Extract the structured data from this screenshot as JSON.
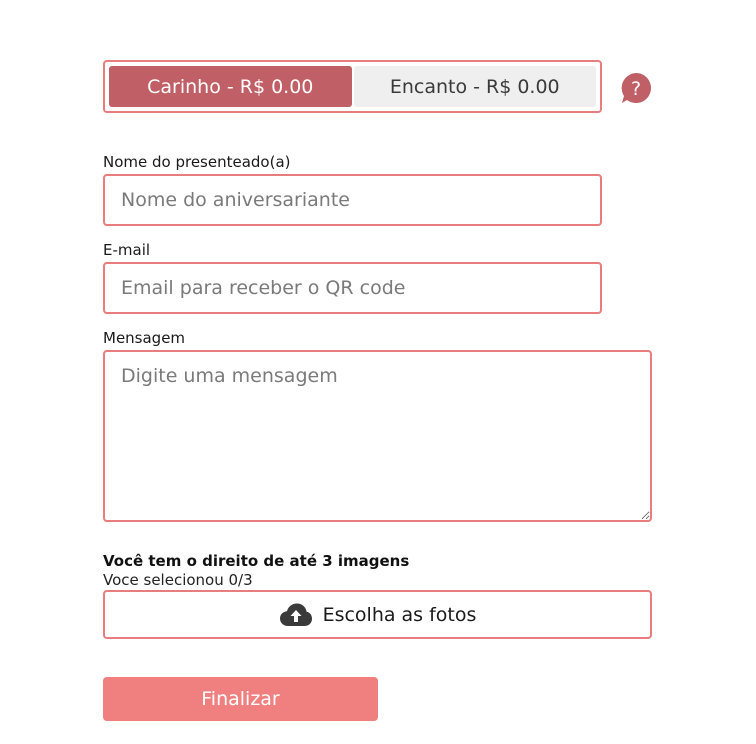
{
  "plans": [
    {
      "label": "Carinho - R$ 0.00",
      "selected": true
    },
    {
      "label": "Encanto - R$ 0.00",
      "selected": false
    }
  ],
  "help": {
    "icon": "question-mark-icon",
    "glyph": "?"
  },
  "fields": {
    "name": {
      "label": "Nome do presenteado(a)",
      "placeholder": "Nome do aniversariante",
      "value": ""
    },
    "email": {
      "label": "E-mail",
      "placeholder": "Email para receber o QR code",
      "value": ""
    },
    "message": {
      "label": "Mensagem",
      "placeholder": "Digite uma mensagem",
      "value": ""
    }
  },
  "images": {
    "title": "Você tem o direito de até 3 imagens",
    "count_text": "Voce selecionou 0/3",
    "upload_label": "Escolha as fotos",
    "upload_icon": "cloud-upload-icon"
  },
  "submit": {
    "label": "Finalizar"
  },
  "colors": {
    "accent_border": "#e97c7c",
    "selected_plan_bg": "#c05f66",
    "submit_bg": "#f08080",
    "help_icon": "#c05f66"
  }
}
